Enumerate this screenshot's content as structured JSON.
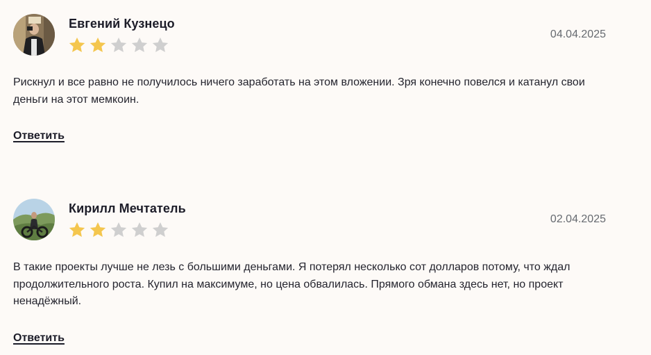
{
  "colors": {
    "background": "#fdfaf7",
    "star_filled": "#f4c64e",
    "star_empty": "#cfcfcf",
    "text": "#24242e",
    "date": "#666a70"
  },
  "reviews": [
    {
      "author": "Евгений Кузнецо",
      "date": "04.04.2025",
      "rating": 2,
      "max_rating": 5,
      "text": "Рискнул и все равно не получилось ничего заработать на этом вложении. Зря конечно повелся и катанул свои деньги на этот мемкоин.",
      "reply_label": "Ответить"
    },
    {
      "author": "Кирилл Мечтатель",
      "date": "02.04.2025",
      "rating": 2,
      "max_rating": 5,
      "text": "В такие проекты лучше не лезь с большими деньгами. Я потерял несколько сот долларов потому, что ждал продолжительного роста. Купил на максимуме, но цена обвалилась. Прямого обмана здесь нет, но проект ненадёжный.",
      "reply_label": "Ответить"
    }
  ]
}
